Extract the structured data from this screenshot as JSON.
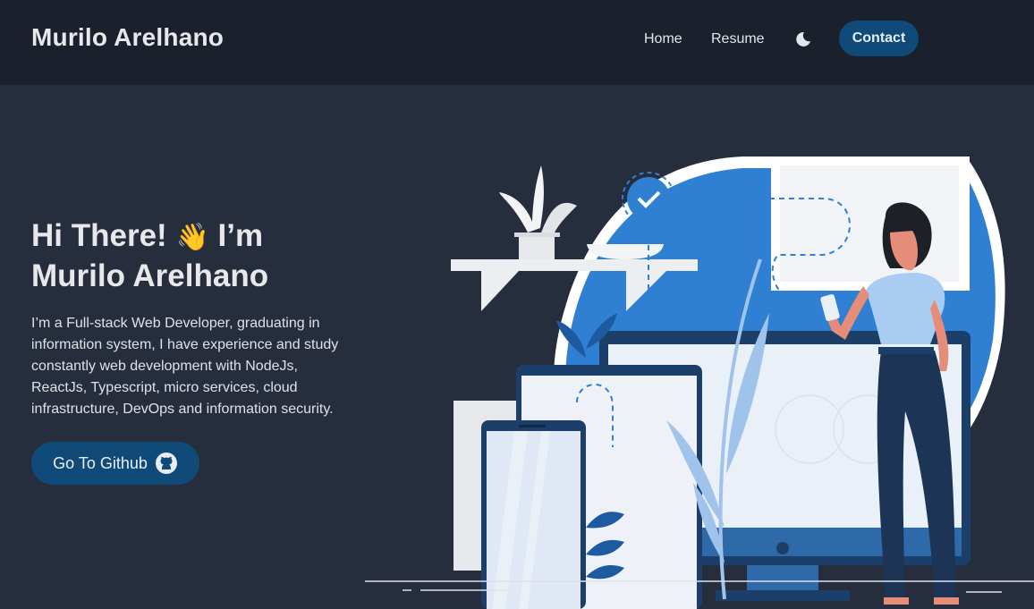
{
  "navbar": {
    "brand": "Murilo Arelhano",
    "links": [
      {
        "label": "Home"
      },
      {
        "label": "Resume"
      }
    ],
    "theme_toggle_icon": "moon-icon",
    "contact_label": "Contact"
  },
  "hero": {
    "title_line1": "Hi There!",
    "wave_emoji": "👋",
    "title_im": "I’m",
    "title_line2": "Murilo Arelhano",
    "description": "I’m a Full-stack Web Developer, graduating in information system, I have experience and study constantly web development with NodeJs, ReactJs, Typescript, micro services, cloud infrastructure, DevOps and information security.",
    "github_label": "Go To Github",
    "github_icon": "github-icon"
  },
  "colors": {
    "page_bg": "#262d3d",
    "navbar_bg": "#1a202c",
    "button_bg": "#0f4a78",
    "accent_blue": "#2f80d3"
  }
}
